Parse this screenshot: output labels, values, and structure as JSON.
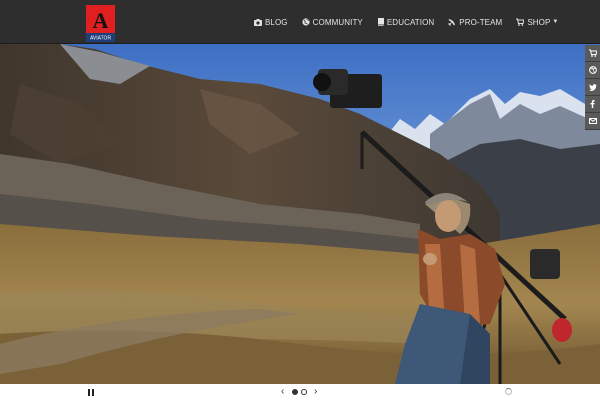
{
  "brand": {
    "logo_letter": "A",
    "logo_text": "AVIATOR",
    "accent": "#e02020"
  },
  "nav": {
    "items": [
      {
        "label": "BLOG",
        "icon": "camera-icon"
      },
      {
        "label": "COMMUNITY",
        "icon": "globe-icon"
      },
      {
        "label": "EDUCATION",
        "icon": "book-icon"
      },
      {
        "label": "PRO-TEAM",
        "icon": "plane-icon"
      },
      {
        "label": "SHOP",
        "icon": "cart-icon",
        "dropdown": true
      }
    ]
  },
  "social": [
    "cart-icon",
    "dribbble-icon",
    "twitter-icon",
    "facebook-icon",
    "mail-icon"
  ],
  "slider": {
    "slide_count": 2,
    "active_slide": 1,
    "prev_label": "‹",
    "next_label": "›"
  }
}
